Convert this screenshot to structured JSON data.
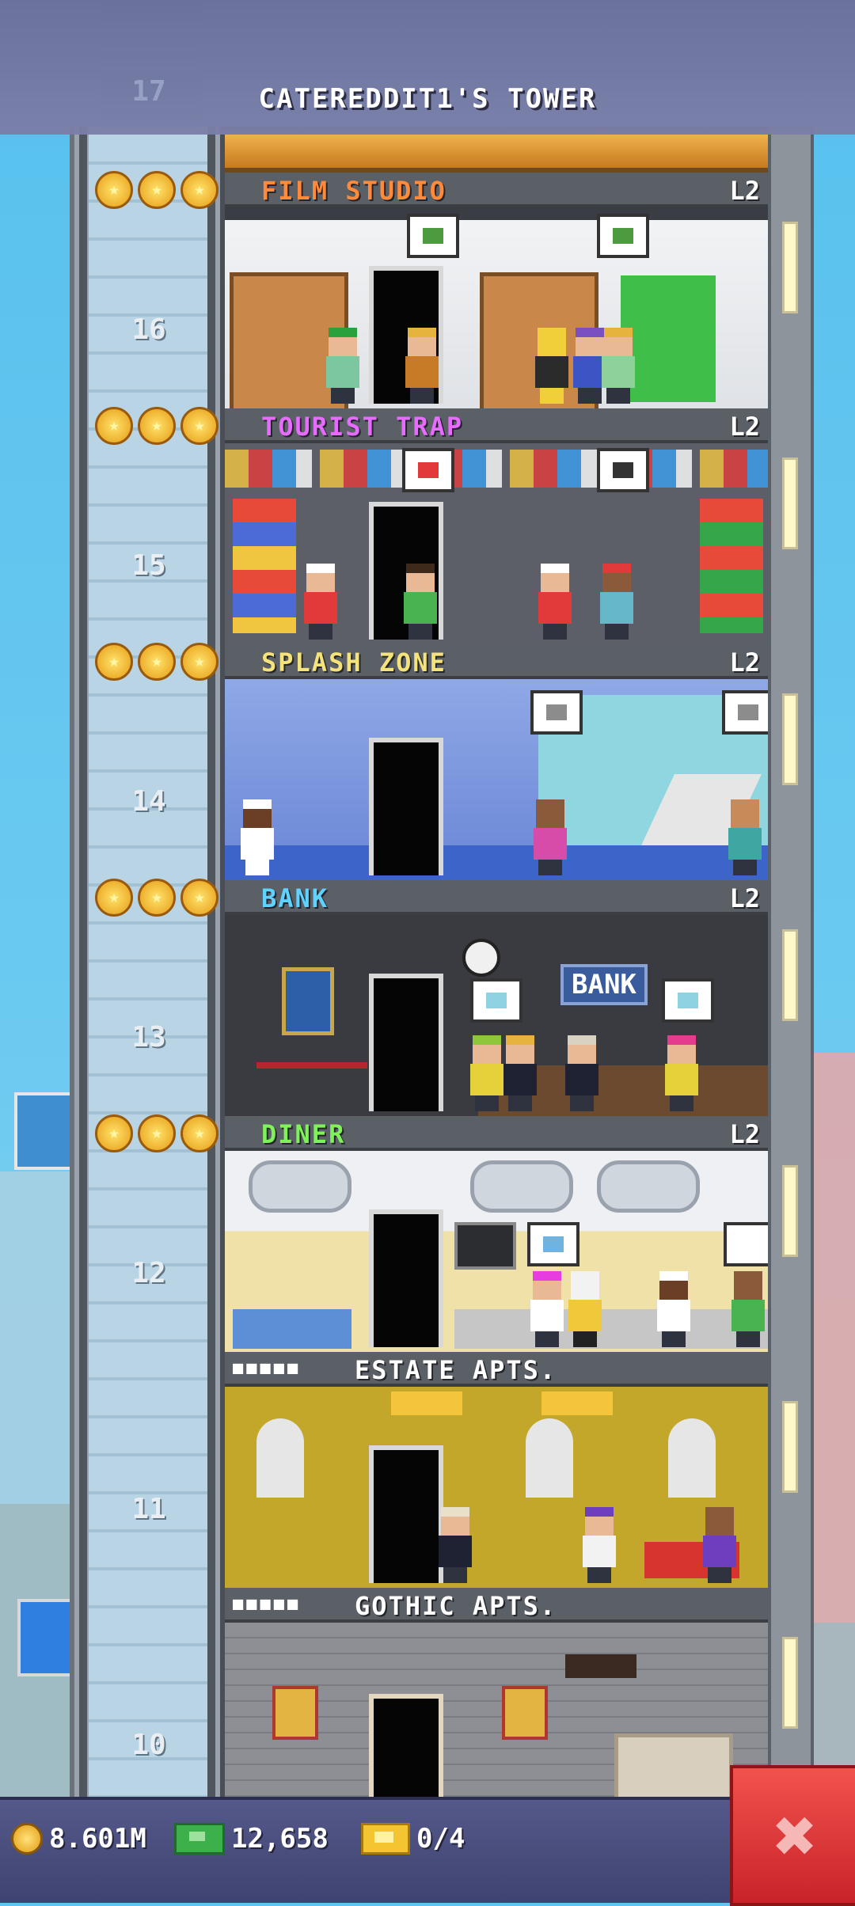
{
  "header": {
    "tower_title": "CATEREDDIT1'S TOWER"
  },
  "colors": {
    "film_studio": "#ff8a3a",
    "tourist_trap": "#e86bff",
    "splash_zone": "#f4e27a",
    "bank": "#5fd3ff",
    "diner": "#7ff25a",
    "residential": "#ffffff"
  },
  "floors": [
    {
      "number": "16",
      "name": "FILM STUDIO",
      "level": "L2",
      "stars": 3,
      "name_color": "#ff8a3a"
    },
    {
      "number": "15",
      "name": "TOURIST TRAP",
      "level": "L2",
      "stars": 3,
      "name_color": "#e86bff"
    },
    {
      "number": "14",
      "name": "SPLASH ZONE",
      "level": "L2",
      "stars": 3,
      "name_color": "#f4e27a"
    },
    {
      "number": "13",
      "name": "BANK",
      "level": "L2",
      "stars": 3,
      "name_color": "#5fd3ff"
    },
    {
      "number": "12",
      "name": "DINER",
      "level": "L2",
      "stars": 3,
      "name_color": "#7ff25a"
    },
    {
      "number": "11",
      "name": "ESTATE APTS.",
      "residents_shown": 5
    },
    {
      "number": "10",
      "name": "GOTHIC APTS.",
      "residents_shown": 5
    }
  ],
  "bank_sign": "BANK",
  "partial_top_floor_number": "17",
  "status_bar": {
    "coins": "8.601M",
    "bux": "12,658",
    "tickets": "0/4"
  },
  "icons": {
    "coins": "coin-icon",
    "bux": "bux-cash-icon",
    "tickets": "ticket-icon",
    "close": "close-x-icon"
  }
}
